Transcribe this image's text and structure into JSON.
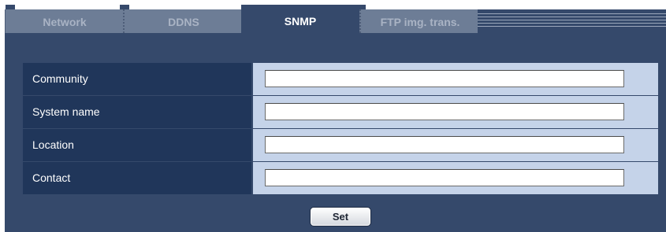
{
  "tabs": [
    {
      "label": "Network",
      "active": false
    },
    {
      "label": "DDNS",
      "active": false
    },
    {
      "label": "SNMP",
      "active": true
    },
    {
      "label": "FTP img. trans.",
      "active": false
    }
  ],
  "form": {
    "rows": [
      {
        "label": "Community",
        "value": ""
      },
      {
        "label": "System name",
        "value": ""
      },
      {
        "label": "Location",
        "value": ""
      },
      {
        "label": "Contact",
        "value": ""
      }
    ]
  },
  "actions": {
    "set_label": "Set"
  },
  "colors": {
    "panel_bg": "#35496b",
    "label_bg": "#20365a",
    "value_bg": "#c5d3e9",
    "inactive_tab": "#6d7d96"
  }
}
